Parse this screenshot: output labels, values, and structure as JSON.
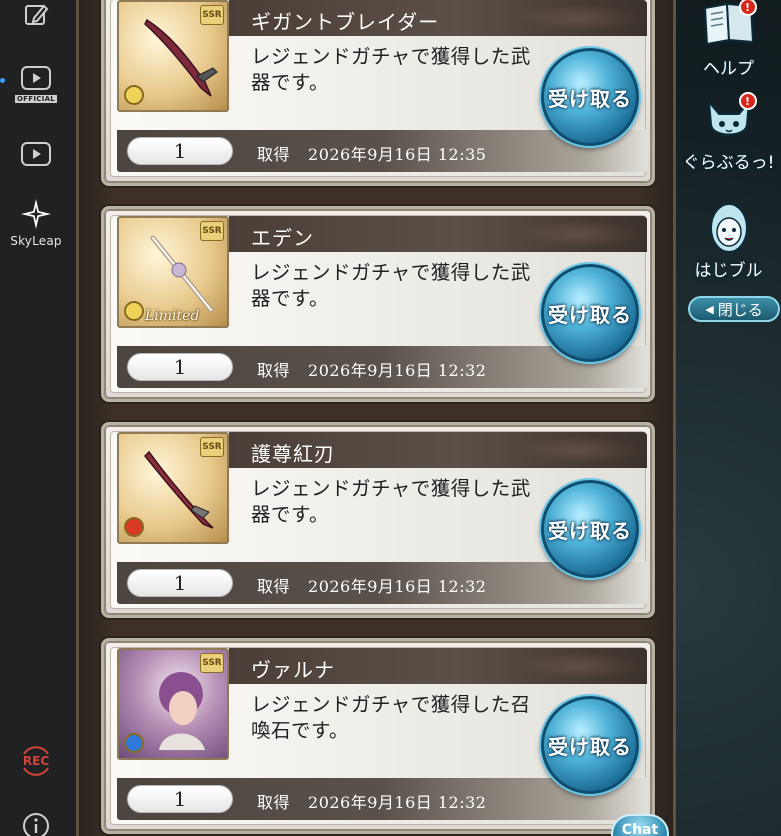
{
  "sidebar": {
    "items": [
      {
        "name": "edit",
        "label": ""
      },
      {
        "name": "official-video",
        "tag": "OFFICIAL"
      },
      {
        "name": "video",
        "label": ""
      },
      {
        "name": "skyleap",
        "label": "SkyLeap"
      },
      {
        "name": "record",
        "label": "REC"
      },
      {
        "name": "info",
        "label": ""
      }
    ]
  },
  "items": [
    {
      "name": "ギガントブレイダー",
      "description": "レジェンドガチャで獲得した武器です。",
      "quantity": "1",
      "obtained_label": "取得",
      "timestamp": "2026年9月16日 12:35",
      "button": "受け取る",
      "rarity": "SSR",
      "element": "light",
      "limited": ""
    },
    {
      "name": "エデン",
      "description": "レジェンドガチャで獲得した武器です。",
      "quantity": "1",
      "obtained_label": "取得",
      "timestamp": "2026年9月16日 12:32",
      "button": "受け取る",
      "rarity": "SSR",
      "element": "light",
      "limited": "Limited"
    },
    {
      "name": "護尊紅刃",
      "description": "レジェンドガチャで獲得した武器です。",
      "quantity": "1",
      "obtained_label": "取得",
      "timestamp": "2026年9月16日 12:32",
      "button": "受け取る",
      "rarity": "SSR",
      "element": "fire",
      "limited": ""
    },
    {
      "name": "ヴァルナ",
      "description": "レジェンドガチャで獲得した召喚石です。",
      "quantity": "1",
      "obtained_label": "取得",
      "timestamp": "2026年9月16日 12:32",
      "button": "受け取る",
      "rarity": "SSR",
      "element": "water",
      "limited": ""
    }
  ],
  "right_menu": {
    "help": "ヘルプ",
    "guraburu": "ぐらぶるっ!",
    "hajiburu": "はじブル",
    "close": "閉じる",
    "badge": "!"
  },
  "chat": "Chat",
  "colors": {
    "accent_button": "#1b6c96",
    "title_bar": "#4a3f38",
    "badge": "#d7261c"
  }
}
